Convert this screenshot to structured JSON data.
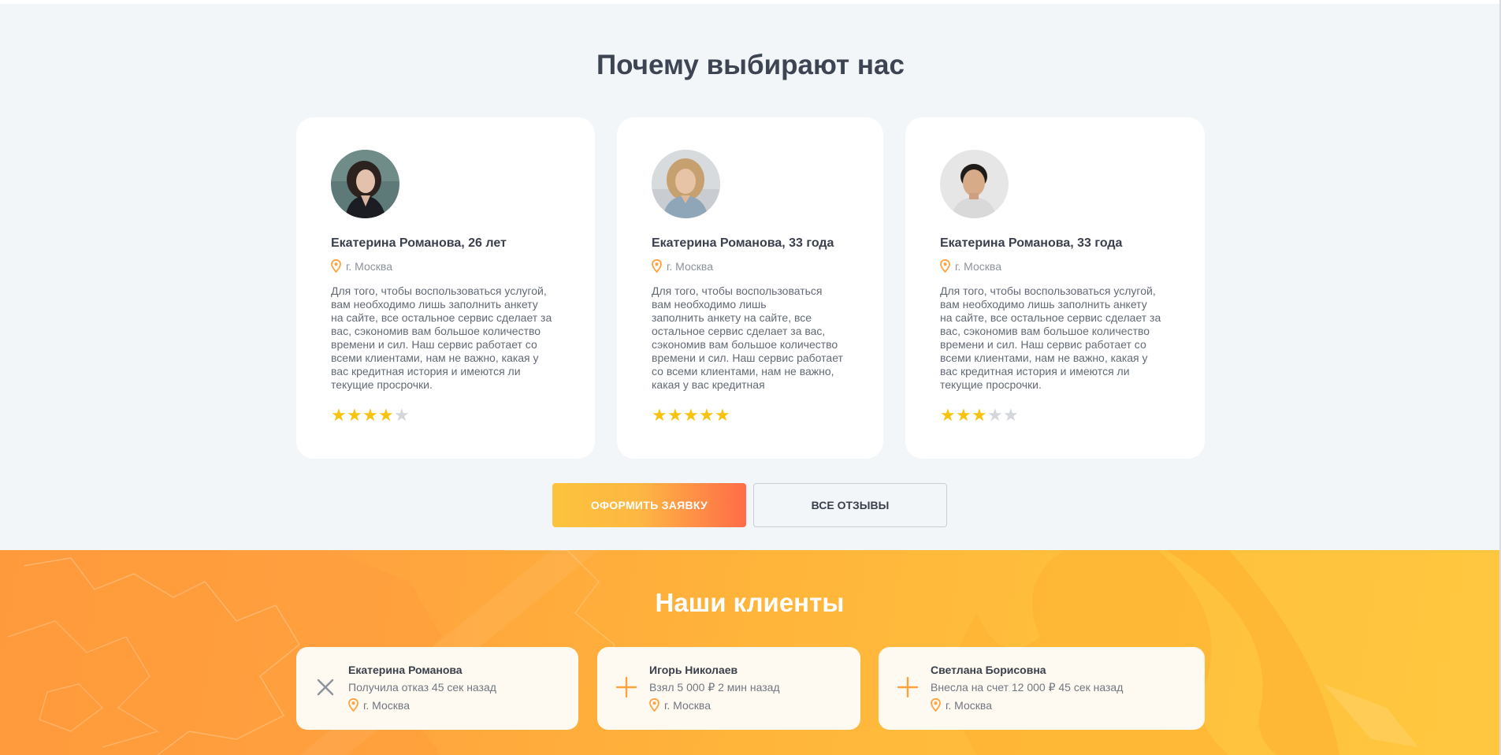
{
  "reviews": {
    "title": "Почему выбирают нас",
    "cards": [
      {
        "name": "Екатерина Романова, 26 лет",
        "city": "г. Москва",
        "text_lines": [
          "Для того, чтобы воспользоваться услугой,",
          "вам необходимо лишь заполнить анкету",
          "на сайте, все остальное сервис сделает за",
          "вас, сэкономив вам большое количество",
          "времени и сил. Наш сервис работает со",
          "всеми клиентами, нам не важно, какая у",
          "вас кредитная история и имеются ли",
          "текущие просрочки."
        ],
        "rating": 4
      },
      {
        "name": "Екатерина Романова, 33 года",
        "city": "г. Москва",
        "text_lines": [
          "Для того, чтобы воспользоваться",
          "вам необходимо лишь",
          "заполнить анкету на сайте, все",
          "остальное сервис сделает за вас,",
          "сэкономив вам большое количество",
          "времени и сил. Наш сервис работает",
          "со всеми клиентами, нам не важно,",
          "какая у вас кредитная"
        ],
        "rating": 5
      },
      {
        "name": "Екатерина Романова, 33 года",
        "city": "г. Москва",
        "text_lines": [
          "Для того, чтобы воспользоваться услугой,",
          "вам необходимо лишь заполнить анкету",
          "на сайте, все остальное сервис сделает за",
          "вас, сэкономив вам большое количество",
          "времени и сил. Наш сервис работает со",
          "всеми клиентами, нам не важно, какая у",
          "вас кредитная история и имеются ли",
          "текущие просрочки."
        ],
        "rating": 3
      }
    ],
    "apply_button": "ОФОРМИТЬ ЗАЯВКУ",
    "all_reviews_button": "ВСЕ ОТЗЫВЫ"
  },
  "clients": {
    "title": "Наши клиенты",
    "cards": [
      {
        "name": "Екатерина Романова",
        "status": "Получила отказ 45 сек назад",
        "city": "г. Москва",
        "icon": "close-icon"
      },
      {
        "name": "Игорь Николаев",
        "status": "Взял 5 000 ₽ 2 мин назад",
        "city": "г. Москва",
        "icon": "plus-icon"
      },
      {
        "name": "Светлана Борисовна",
        "status": "Внесла на счет 12 000 ₽ 45 сек назад",
        "city": "г. Москва",
        "icon": "plus-icon"
      }
    ]
  },
  "colors": {
    "accent_orange": "#ff9a3c",
    "star_filled": "#f8c30f",
    "star_empty": "#d3d6db",
    "pin": "#ffa23f",
    "close_icon": "#8b929c"
  }
}
